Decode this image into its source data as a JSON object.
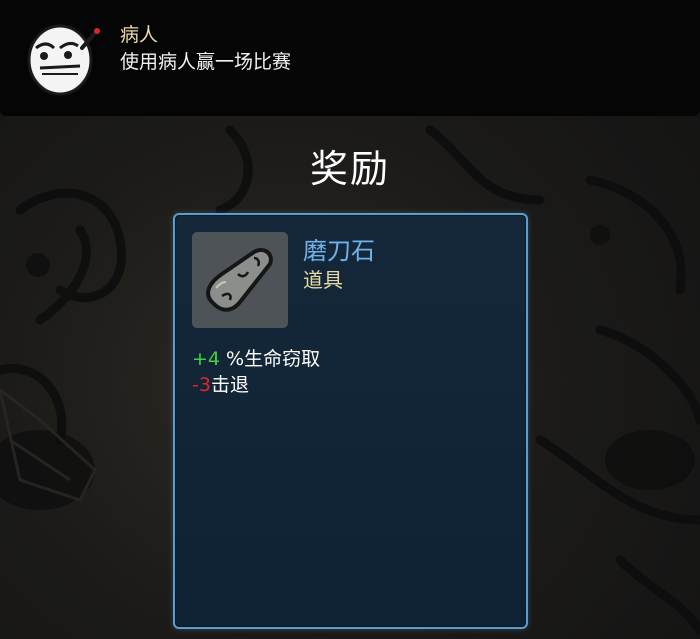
{
  "achievement": {
    "title": "病人",
    "description": "使用病人赢一场比赛",
    "icon": "patient-character-icon"
  },
  "reward": {
    "heading": "奖励",
    "item": {
      "name": "磨刀石",
      "type": "道具",
      "icon": "whetstone-icon",
      "stats": [
        {
          "value": "+4",
          "label": " %生命窃取",
          "tone": "positive"
        },
        {
          "value": "-3",
          "label": "击退",
          "tone": "negative"
        }
      ]
    }
  },
  "colors": {
    "item_name": "#6fb2ea",
    "item_type": "#e9d9a2",
    "positive": "#3fd142",
    "negative": "#e0262b",
    "card_border": "#5b9ecd"
  }
}
